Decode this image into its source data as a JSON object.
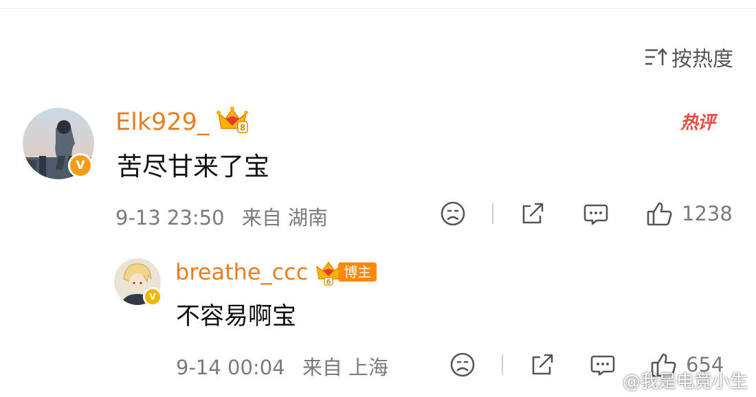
{
  "sort": {
    "label": "按热度"
  },
  "comment": {
    "username": "Elk929_",
    "hot_tag": "热评",
    "text": "苦尽甘来了宝",
    "time": "9-13 23:50",
    "location": "来自 湖南",
    "likes": "1238",
    "verified_mark": "V"
  },
  "reply": {
    "username": "breathe_ccc",
    "badge": "博主",
    "text": "不容易啊宝",
    "time": "9-14 00:04",
    "location": "来自 上海",
    "likes": "654",
    "verified_mark": "V"
  },
  "watermark": {
    "text": "@我是电竞小生"
  },
  "colors": {
    "accent": "#e67e22",
    "badge_orange": "#ff8a00",
    "hot_red": "#e74c3c",
    "meta_gray": "#7a7a7a"
  }
}
